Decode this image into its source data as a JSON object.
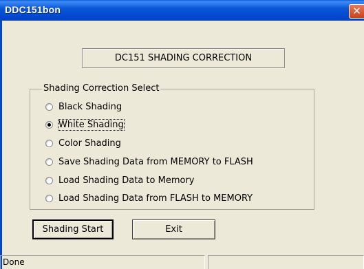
{
  "window": {
    "title": "DDC151bon",
    "close_label": "✕"
  },
  "heading": "DC151 SHADING CORRECTION",
  "group": {
    "label": "Shading Correction Select",
    "options": [
      {
        "label": "Black Shading",
        "checked": false
      },
      {
        "label": "White Shading",
        "checked": true
      },
      {
        "label": "Color Shading",
        "checked": false
      },
      {
        "label": "Save Shading Data from MEMORY to FLASH",
        "checked": false
      },
      {
        "label": "Load Shading Data to Memory",
        "checked": false
      },
      {
        "label": "Load Shading Data from FLASH to MEMORY",
        "checked": false
      }
    ]
  },
  "buttons": {
    "start": "Shading Start",
    "exit": "Exit"
  },
  "status": {
    "text": "Done",
    "panel2": ""
  },
  "colors": {
    "titlebar": "#0a5fd7",
    "face": "#ece9d8",
    "close": "#d9532c"
  }
}
